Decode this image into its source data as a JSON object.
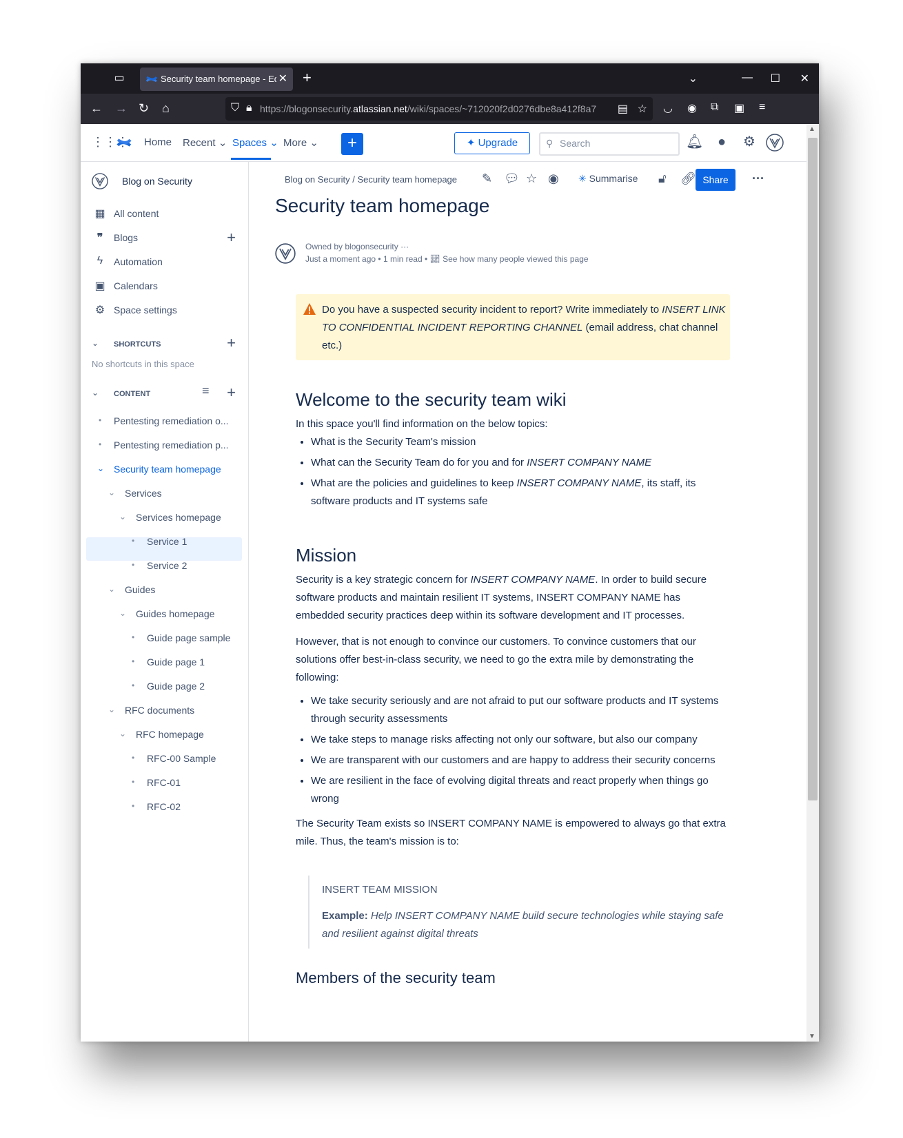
{
  "browser": {
    "tab_title": "Security team homepage - Edi",
    "url_prefix": "https://blogonsecurity.",
    "url_host": "atlassian.net",
    "url_rest": "/wiki/spaces/~712020f2d0276dbe8a412f8a7"
  },
  "topnav": {
    "home": "Home",
    "recent": "Recent",
    "spaces": "Spaces",
    "more": "More",
    "upgrade": "Upgrade",
    "search_placeholder": "Search"
  },
  "sidebar": {
    "space_name": "Blog on Security",
    "items": [
      {
        "label": "All content",
        "icon": "grid-icon"
      },
      {
        "label": "Blogs",
        "icon": "quote-icon"
      },
      {
        "label": "Automation",
        "icon": "lightning-icon"
      },
      {
        "label": "Calendars",
        "icon": "calendar-icon"
      },
      {
        "label": "Space settings",
        "icon": "gear-icon"
      }
    ],
    "shortcuts_label": "SHORTCUTS",
    "no_shortcuts": "No shortcuts in this space",
    "content_label": "CONTENT",
    "tree": [
      "Pentesting remediation o...",
      "Pentesting remediation p...",
      "Security team homepage",
      "Services",
      "Services homepage",
      "Service 1",
      "Service 2",
      "Guides",
      "Guides homepage",
      "Guide page sample",
      "Guide page 1",
      "Guide page 2",
      "RFC documents",
      "RFC homepage",
      "RFC-00 Sample",
      "RFC-01",
      "RFC-02"
    ]
  },
  "page": {
    "breadcrumb": "Blog on Security / Security team homepage",
    "summarise": "Summarise",
    "share": "Share",
    "title": "Security team homepage",
    "owned_by": "Owned by blogonsecurity",
    "time": "Just a moment ago",
    "read": "1 min read",
    "views": "See how many people viewed this page",
    "warning_a": "Do you have a suspected security incident to report? Write immediately to ",
    "warning_b": "INSERT LINK TO CONFIDENTIAL INCIDENT REPORTING CHANNEL",
    "warning_c": " (email address, chat channel etc.)",
    "h_welcome": "Welcome to the security team wiki",
    "intro": "In this space you'll find information on the below topics:",
    "topic1": "What is the Security Team's mission",
    "topic2_a": "What can the Security Team do for you and for ",
    "company": "INSERT COMPANY NAME",
    "topic3_a": "What are the policies and guidelines to keep ",
    "topic3_b": ", its staff, its software products and IT systems safe",
    "h_mission": "Mission",
    "m1_a": "Security is a key strategic concern for ",
    "m1_b": ". In order to build secure software products and maintain resilient IT systems, INSERT COMPANY NAME has embedded security practices deep within its software development and IT processes.",
    "m2": "However, that is not enough to convince our customers. To convince customers that our solutions offer best-in-class security, we need to go the extra mile by demonstrating the following:",
    "b1": "We take security seriously and are not afraid to put our software products and IT systems through security assessments",
    "b2": "We take steps to manage risks affecting not only our software, but also our company",
    "b3": "We are transparent with our customers and are happy to address their security concerns",
    "b4": "We are resilient in the face of evolving digital threats and react properly when things go wrong",
    "m3": "The Security Team exists so INSERT COMPANY NAME is empowered to always go that extra mile. Thus, the team's mission is to:",
    "quote_title": "INSERT TEAM MISSION",
    "quote_label": "Example:",
    "quote_text": " Help INSERT COMPANY NAME build secure technologies while staying safe and resilient against digital threats",
    "h_members": "Members of the security team"
  },
  "colors": {
    "accent": "#0c66e4",
    "warning_bg": "#fff7d6",
    "warning_icon": "#e56910",
    "browser_dark": "#1c1b22"
  }
}
